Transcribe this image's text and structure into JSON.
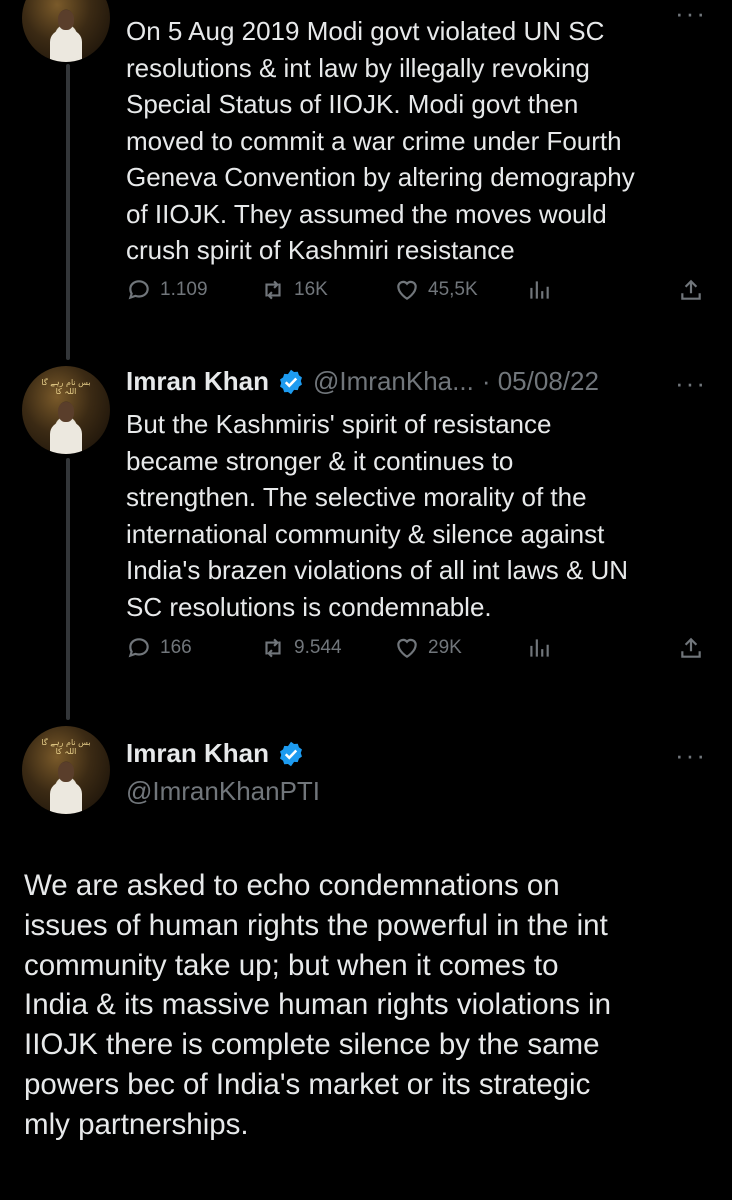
{
  "tweet1": {
    "text": "On 5 Aug 2019 Modi govt violated UN SC\nresolutions & int law by illegally revoking\nSpecial Status of IIOJK. Modi govt then\nmoved to commit a war crime under Fourth\nGeneva Convention by altering demography\nof IIOJK. They assumed the moves would\ncrush spirit of Kashmiri resistance",
    "replies": "1.109",
    "retweets": "16K",
    "likes": "45,5K",
    "icons": [
      "reply-icon",
      "retweet-icon",
      "like-icon",
      "views-icon",
      "share-icon"
    ]
  },
  "tweet2": {
    "name": "Imran Khan",
    "handle": "@ImranKha...",
    "date": "· 05/08/22",
    "text": "But the Kashmiris' spirit of resistance\nbecame stronger & it continues to\nstrengthen. The selective morality of the\ninternational community & silence against\nIndia's brazen violations of all int laws & UN\nSC resolutions is condemnable.",
    "replies": "166",
    "retweets": "9.544",
    "likes": "29K",
    "more": "···"
  },
  "tweet3": {
    "name": "Imran Khan",
    "handle": "@ImranKhanPTI",
    "more": "···",
    "text": "We are asked to echo condemnations on\nissues of human rights the powerful  in the int\ncommunity take up; but when it comes to\nIndia & its massive human rights violations in\nIIOJK there is complete silence by the same\npowers bec of India's market or its strategic\nmly partnerships."
  },
  "avatar_text": "بس نام رہے گا اللہ کا",
  "colors": {
    "background": "#000000",
    "text": "#e7e9ea",
    "secondary": "#71767b",
    "verified": "#1d9bf0",
    "thread_line": "#333639"
  }
}
